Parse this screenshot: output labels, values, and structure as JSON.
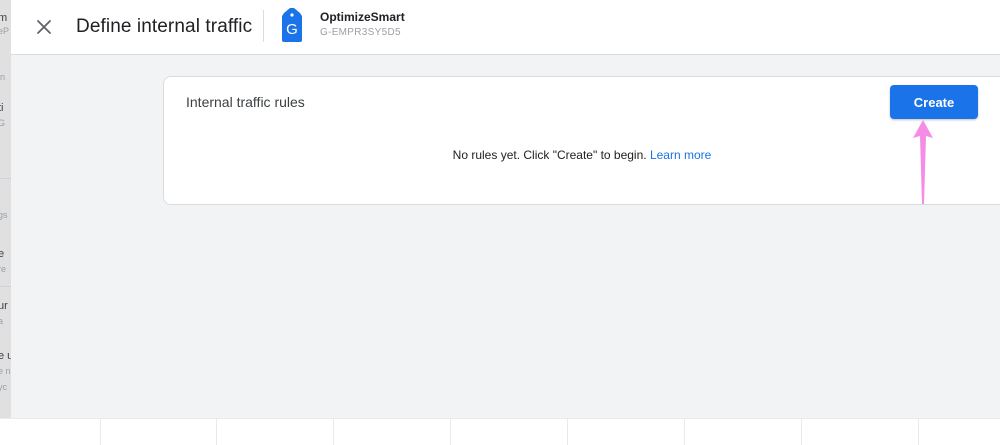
{
  "header": {
    "title": "Define internal traffic",
    "close_icon": "close-icon",
    "property": {
      "icon": "google-analytics-property-icon",
      "icon_letter": "G",
      "name": "OptimizeSmart",
      "id": "G-EMPR3SY5D5"
    }
  },
  "card": {
    "title": "Internal traffic rules",
    "create_label": "Create",
    "empty_message": "No rules yet. Click \"Create\" to begin.",
    "learn_more_label": "Learn more"
  },
  "background_fragments": [
    "m",
    "eP",
    "in",
    "ti",
    "G",
    "gs",
    "e",
    "re",
    "ur",
    "a",
    "e u",
    "e n",
    "yc"
  ],
  "colors": {
    "accent": "#1a73e8",
    "annotation_arrow": "#f58ce6",
    "page_background": "#f1f3f4"
  }
}
